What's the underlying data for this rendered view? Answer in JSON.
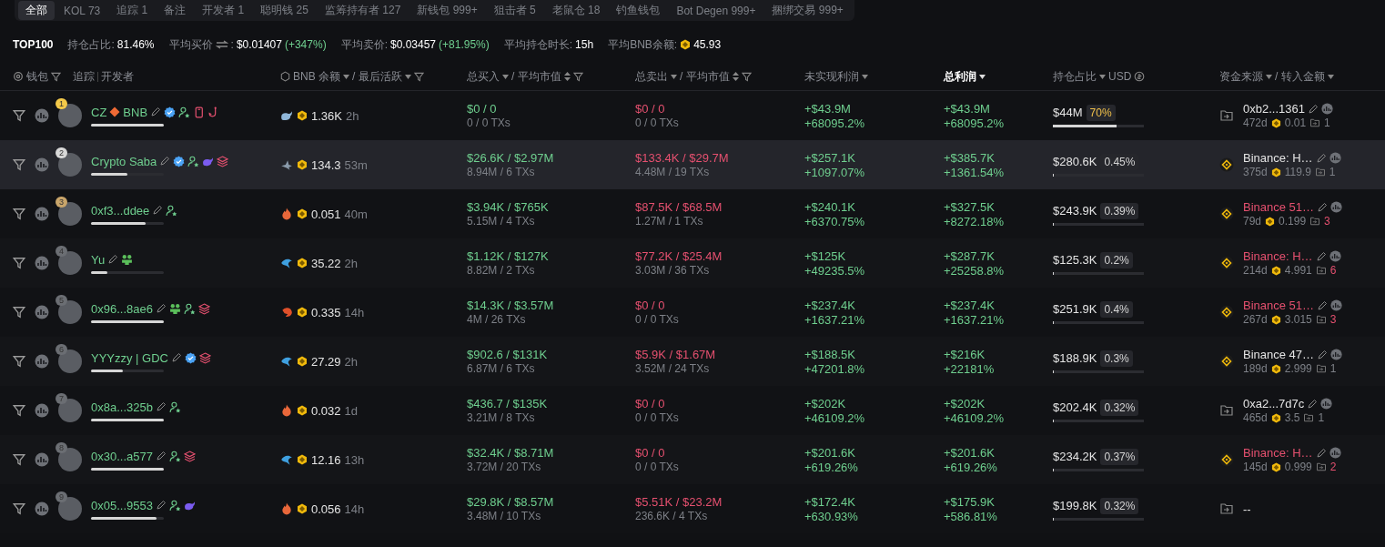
{
  "tabs": [
    {
      "label": "全部",
      "selected": true
    },
    {
      "label": "KOL 73",
      "selected": false
    },
    {
      "label": "追踪 1",
      "selected": false
    },
    {
      "label": "备注",
      "selected": false
    },
    {
      "label": "开发者 1",
      "selected": false
    },
    {
      "label": "聪明钱 25",
      "selected": false
    },
    {
      "label": "监筹持有者 127",
      "selected": false
    },
    {
      "label": "新钱包 999+",
      "selected": false
    },
    {
      "label": "狙击者 5",
      "selected": false
    },
    {
      "label": "老鼠仓 18",
      "selected": false
    },
    {
      "label": "钓鱼钱包",
      "selected": false
    },
    {
      "label": "Bot Degen 999+",
      "selected": false
    },
    {
      "label": "捆绑交易 999+",
      "selected": false
    }
  ],
  "stats": {
    "title": "TOP100",
    "items": [
      {
        "kind": "plain",
        "label": "持仓占比:",
        "value": "81.46%"
      },
      {
        "kind": "swap",
        "label": "平均买价",
        "label_end": ":",
        "value": "$0.01407",
        "change": "(+347%)"
      },
      {
        "kind": "plain",
        "label": "平均卖价:",
        "value": "$0.03457",
        "change": "(+81.95%)"
      },
      {
        "kind": "plain",
        "label": "平均持仓时长:",
        "value": "15h"
      },
      {
        "kind": "bnb",
        "label": "平均BNB余额:",
        "value": "45.93"
      }
    ]
  },
  "header": {
    "wallet": "钱包",
    "track": "追踪",
    "dev": "开发者",
    "bnb": "BNB 余额",
    "last_active": "/ 最后活跃",
    "buy": "总买入",
    "buy_avg": "/ 平均市值",
    "sell": "总卖出",
    "sell_avg": "/ 平均市值",
    "unrealized": "未实现利润",
    "total": "总利润",
    "holding": "持仓占比",
    "holding_unit": "USD",
    "source": "资金来源",
    "source_amount": "/ 转入金额"
  },
  "rows": [
    {
      "rank": "1",
      "color": "#f3c94a",
      "hovered": false,
      "name": "CZ",
      "name_suffix": "BNB",
      "tags": [
        {
          "kind": "verified"
        },
        {
          "kind": "follow"
        },
        {
          "kind": "phone"
        },
        {
          "kind": "fish"
        }
      ],
      "level": 1.0,
      "wallet": {
        "kind": "whale",
        "bnb": "1.36K",
        "last_active": "2h"
      },
      "buy": "$0 / 0",
      "buy_txs": "0 / 0 TXs",
      "sell": "$0 / 0",
      "sell_txs": "0 / 0 TXs",
      "unrealized": "+$43.9M",
      "unrealized_pct": "+68095.2%",
      "total": "+$43.9M",
      "total_pct": "+68095.2%",
      "holding": {
        "value": "$44M",
        "pct": "70%",
        "top": true,
        "level": 0.7
      },
      "source": {
        "kind": "transfer",
        "name": "0xb2...1361",
        "flagged": false,
        "age": "472d",
        "bnb": "0.01",
        "count": "1"
      }
    },
    {
      "rank": "2",
      "color": "#d8d8d8",
      "hovered": true,
      "name": "Crypto Saba",
      "tags": [
        {
          "kind": "verified"
        },
        {
          "kind": "follow"
        },
        {
          "kind": "whale"
        },
        {
          "kind": "stack"
        }
      ],
      "level": 0.5,
      "wallet": {
        "kind": "shark",
        "bnb": "134.3",
        "last_active": "53m"
      },
      "buy": "$26.6K / $2.97M",
      "buy_txs": "8.94M / 6 TXs",
      "sell": "$133.4K / $29.7M",
      "sell_txs": "4.48M / 19 TXs",
      "unrealized": "+$257.1K",
      "unrealized_pct": "+1097.07%",
      "total": "+$385.7K",
      "total_pct": "+1361.54%",
      "holding": {
        "value": "$280.6K",
        "pct": "0.45%",
        "top": false,
        "level": 0.0045
      },
      "source": {
        "kind": "binance",
        "name": "Binance: H…",
        "flagged": false,
        "age": "375d",
        "bnb": "119.9",
        "count": "1"
      }
    },
    {
      "rank": "3",
      "color": "#c9a56a",
      "hovered": false,
      "name": "0xf3...ddee",
      "tags": [
        {
          "kind": "follow"
        }
      ],
      "level": 0.75,
      "wallet": {
        "kind": "fire",
        "bnb": "0.051",
        "last_active": "40m"
      },
      "buy": "$3.94K / $765K",
      "buy_txs": "5.15M / 4 TXs",
      "sell": "$87.5K / $68.5M",
      "sell_txs": "1.27M / 1 TXs",
      "unrealized": "+$240.1K",
      "unrealized_pct": "+6370.75%",
      "total": "+$327.5K",
      "total_pct": "+8272.18%",
      "holding": {
        "value": "$243.9K",
        "pct": "0.39%",
        "top": false,
        "level": 0.0039
      },
      "source": {
        "kind": "binance",
        "name": "Binance 51…",
        "flagged": true,
        "age": "79d",
        "bnb": "0.199",
        "count": "3"
      }
    },
    {
      "rank": "4",
      "color": "#6b6e73",
      "hovered": false,
      "name": "Yu",
      "tags": [
        {
          "kind": "frog"
        }
      ],
      "level": 0.22,
      "wallet": {
        "kind": "dolphin",
        "bnb": "35.22",
        "last_active": "2h"
      },
      "buy": "$1.12K / $127K",
      "buy_txs": "8.82M / 2 TXs",
      "sell": "$77.2K / $25.4M",
      "sell_txs": "3.03M / 36 TXs",
      "unrealized": "+$125K",
      "unrealized_pct": "+49235.5%",
      "total": "+$287.7K",
      "total_pct": "+25258.8%",
      "holding": {
        "value": "$125.3K",
        "pct": "0.2%",
        "top": false,
        "level": 0.002
      },
      "source": {
        "kind": "binance",
        "name": "Binance: H…",
        "flagged": true,
        "age": "214d",
        "bnb": "4.991",
        "count": "6"
      }
    },
    {
      "rank": "5",
      "color": "#6b6e73",
      "hovered": false,
      "name": "0x96...8ae6",
      "tags": [
        {
          "kind": "frog"
        },
        {
          "kind": "follow"
        },
        {
          "kind": "stack"
        }
      ],
      "level": 1.0,
      "wallet": {
        "kind": "shrimp",
        "bnb": "0.335",
        "last_active": "14h"
      },
      "buy": "$14.3K / $3.57M",
      "buy_txs": "4M / 26 TXs",
      "sell": "$0 / 0",
      "sell_txs": "0 / 0 TXs",
      "unrealized": "+$237.4K",
      "unrealized_pct": "+1637.21%",
      "total": "+$237.4K",
      "total_pct": "+1637.21%",
      "holding": {
        "value": "$251.9K",
        "pct": "0.4%",
        "top": false,
        "level": 0.004
      },
      "source": {
        "kind": "binance",
        "name": "Binance 51…",
        "flagged": true,
        "age": "267d",
        "bnb": "3.015",
        "count": "3"
      }
    },
    {
      "rank": "6",
      "color": "#6b6e73",
      "hovered": false,
      "name": "YYYzzy | GDC",
      "tags": [
        {
          "kind": "verified"
        },
        {
          "kind": "stack"
        }
      ],
      "level": 0.44,
      "wallet": {
        "kind": "dolphin",
        "bnb": "27.29",
        "last_active": "2h"
      },
      "buy": "$902.6 / $131K",
      "buy_txs": "6.87M / 6 TXs",
      "sell": "$5.9K / $1.67M",
      "sell_txs": "3.52M / 24 TXs",
      "unrealized": "+$188.5K",
      "unrealized_pct": "+47201.8%",
      "total": "+$216K",
      "total_pct": "+22181%",
      "holding": {
        "value": "$188.9K",
        "pct": "0.3%",
        "top": false,
        "level": 0.003
      },
      "source": {
        "kind": "binance",
        "name": "Binance 47…",
        "flagged": false,
        "age": "189d",
        "bnb": "2.999",
        "count": "1"
      }
    },
    {
      "rank": "7",
      "color": "#6b6e73",
      "hovered": false,
      "name": "0x8a...325b",
      "tags": [
        {
          "kind": "follow"
        }
      ],
      "level": 1.0,
      "wallet": {
        "kind": "fire",
        "bnb": "0.032",
        "last_active": "1d"
      },
      "buy": "$436.7 / $135K",
      "buy_txs": "3.21M / 8 TXs",
      "sell": "$0 / 0",
      "sell_txs": "0 / 0 TXs",
      "unrealized": "+$202K",
      "unrealized_pct": "+46109.2%",
      "total": "+$202K",
      "total_pct": "+46109.2%",
      "holding": {
        "value": "$202.4K",
        "pct": "0.32%",
        "top": false,
        "level": 0.0032
      },
      "source": {
        "kind": "transfer",
        "name": "0xa2...7d7c",
        "flagged": false,
        "age": "465d",
        "bnb": "3.5",
        "count": "1"
      }
    },
    {
      "rank": "8",
      "color": "#6b6e73",
      "hovered": false,
      "name": "0x30...a577",
      "tags": [
        {
          "kind": "follow"
        },
        {
          "kind": "stack"
        }
      ],
      "level": 1.0,
      "wallet": {
        "kind": "dolphin",
        "bnb": "12.16",
        "last_active": "13h"
      },
      "buy": "$32.4K / $8.71M",
      "buy_txs": "3.72M / 20 TXs",
      "sell": "$0 / 0",
      "sell_txs": "0 / 0 TXs",
      "unrealized": "+$201.6K",
      "unrealized_pct": "+619.26%",
      "total": "+$201.6K",
      "total_pct": "+619.26%",
      "holding": {
        "value": "$234.2K",
        "pct": "0.37%",
        "top": false,
        "level": 0.0037
      },
      "source": {
        "kind": "binance",
        "name": "Binance: H…",
        "flagged": true,
        "age": "145d",
        "bnb": "0.999",
        "count": "2"
      }
    },
    {
      "rank": "9",
      "color": "#6b6e73",
      "hovered": false,
      "name": "0x05...9553",
      "tags": [
        {
          "kind": "follow"
        },
        {
          "kind": "whale"
        }
      ],
      "level": 0.9,
      "wallet": {
        "kind": "fire",
        "bnb": "0.056",
        "last_active": "14h"
      },
      "buy": "$29.8K / $8.57M",
      "buy_txs": "3.48M / 10 TXs",
      "sell": "$5.51K / $23.2M",
      "sell_txs": "236.6K / 4 TXs",
      "unrealized": "+$172.4K",
      "unrealized_pct": "+630.93%",
      "total": "+$175.9K",
      "total_pct": "+586.81%",
      "holding": {
        "value": "$199.8K",
        "pct": "0.32%",
        "top": false,
        "level": 0.0032
      },
      "source": {
        "kind": "transfer",
        "name": "--",
        "flagged": false
      }
    }
  ]
}
